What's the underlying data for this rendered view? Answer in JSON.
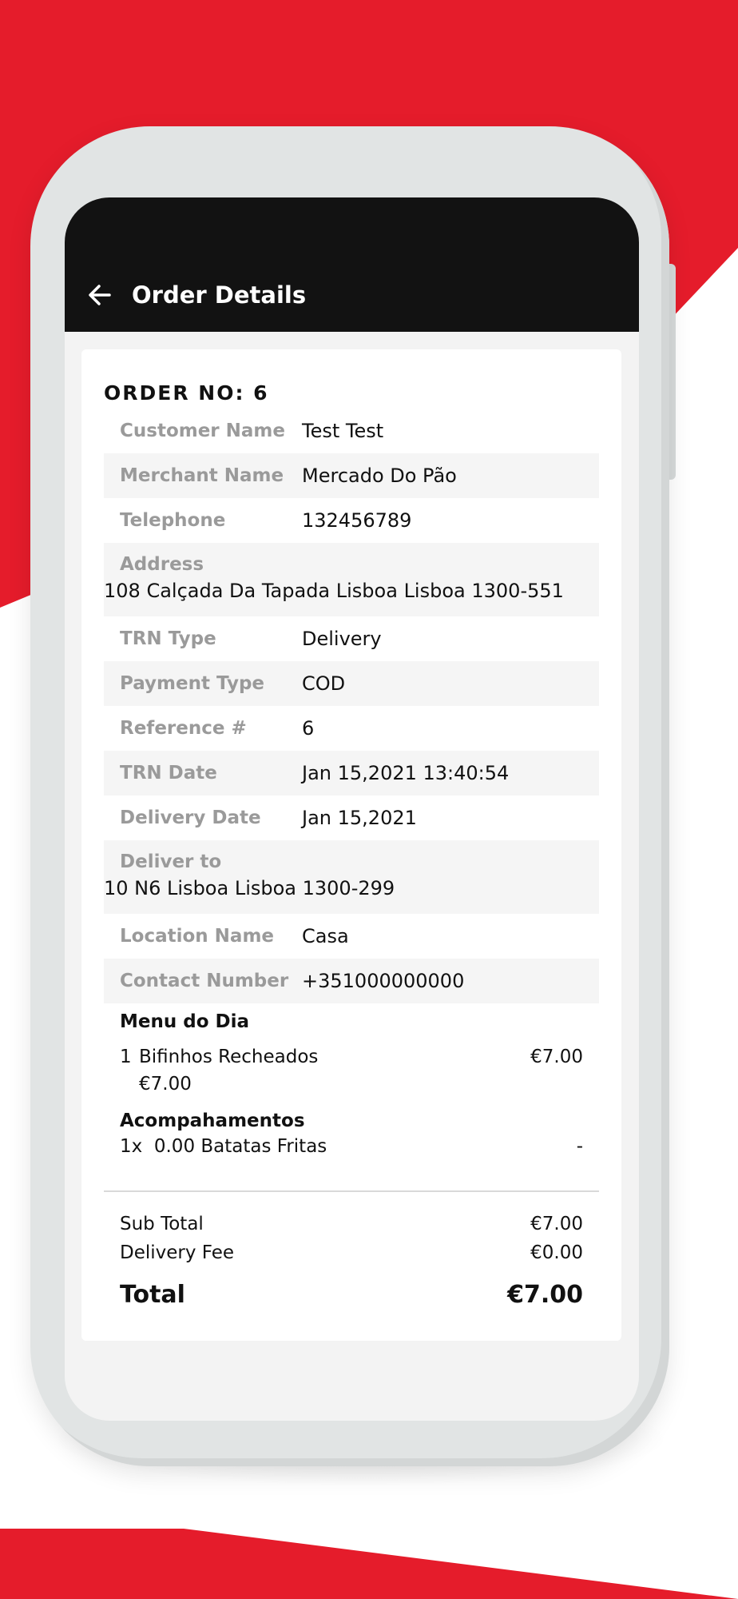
{
  "colors": {
    "brand_red": "#e51c2b",
    "app_bar": "#121212",
    "label_gray": "#9a9a9a"
  },
  "app_bar": {
    "back_icon": "arrow-left-icon",
    "title": "Order Details"
  },
  "order": {
    "heading": "ORDER NO: 6",
    "details": [
      {
        "label": "Customer Name",
        "value": "Test Test",
        "shaded": false,
        "stacked": false
      },
      {
        "label": "Merchant Name",
        "value": "Mercado Do Pão",
        "shaded": true,
        "stacked": false
      },
      {
        "label": "Telephone",
        "value": "132456789",
        "shaded": false,
        "stacked": false
      },
      {
        "label": "Address",
        "value": "108 Calçada Da Tapada Lisboa Lisboa 1300-551",
        "shaded": true,
        "stacked": true
      },
      {
        "label": "TRN Type",
        "value": "Delivery",
        "shaded": false,
        "stacked": false
      },
      {
        "label": "Payment Type",
        "value": "COD",
        "shaded": true,
        "stacked": false
      },
      {
        "label": "Reference #",
        "value": "6",
        "shaded": false,
        "stacked": false
      },
      {
        "label": "TRN Date",
        "value": "Jan 15,2021 13:40:54",
        "shaded": true,
        "stacked": false
      },
      {
        "label": "Delivery Date",
        "value": "Jan 15,2021",
        "shaded": false,
        "stacked": false
      },
      {
        "label": "Deliver to",
        "value": "10 N6 Lisboa Lisboa 1300-299",
        "shaded": true,
        "stacked": true
      },
      {
        "label": "Location Name",
        "value": "Casa",
        "shaded": false,
        "stacked": false
      },
      {
        "label": "Contact Number",
        "value": "+351000000000",
        "shaded": true,
        "stacked": false
      }
    ]
  },
  "menu": {
    "category": "Menu do Dia",
    "item_qty": "1",
    "item_name": "Bifinhos Recheados",
    "item_total": "€7.00",
    "item_unit_price": "€7.00",
    "addon_group": "Acompahamentos",
    "addon_line": "1x  0.00 Batatas Fritas",
    "addon_value": "-"
  },
  "totals": {
    "subtotal_label": "Sub Total",
    "subtotal_value": "€7.00",
    "delivery_label": "Delivery Fee",
    "delivery_value": "€0.00",
    "total_label": "Total",
    "total_value": "€7.00"
  }
}
